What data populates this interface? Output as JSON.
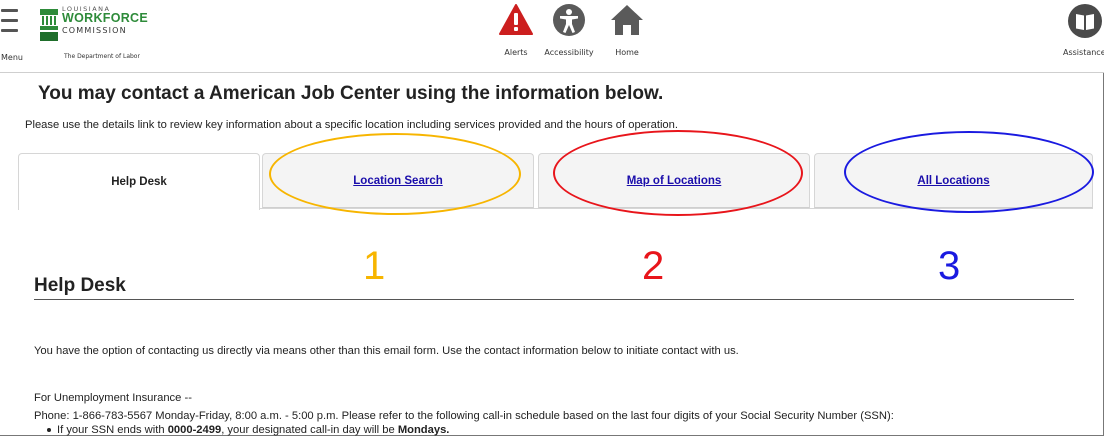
{
  "header": {
    "menu_label": "Menu",
    "logo": {
      "line1": "LOUISIANA",
      "line2": "WORKFORCE",
      "line3": "COMMISSION",
      "tagline": "The Department of Labor"
    },
    "alerts_label": "Alerts",
    "accessibility_label": "Accessibility",
    "home_label": "Home",
    "assistance_label": "Assistance",
    "icons": {
      "menu": "hamburger-icon",
      "alerts": "alert-triangle-icon",
      "accessibility": "accessibility-icon",
      "home": "home-icon",
      "assistance": "book-icon"
    },
    "colors": {
      "alerts": "#cc1f1f",
      "logo_green": "#2e8b3a",
      "icon_gray": "#5a5a5a"
    }
  },
  "main": {
    "title": "You may contact a American Job Center using the information below.",
    "subtitle": "Please use the details link to review key information about a specific location including services provided and the hours of operation."
  },
  "tabs": [
    {
      "label": "Help Desk",
      "active": true
    },
    {
      "label": "Location Search",
      "active": false
    },
    {
      "label": "Map of Locations",
      "active": false
    },
    {
      "label": "All Locations",
      "active": false
    }
  ],
  "annotations": [
    {
      "number": "1",
      "color": "#f7b500"
    },
    {
      "number": "2",
      "color": "#e8151b"
    },
    {
      "number": "3",
      "color": "#1a1ae0"
    }
  ],
  "content": {
    "section_title": "Help Desk",
    "intro": "You have the option of contacting us directly via means other than this email form. Use the contact information below to initiate contact with us.",
    "ui_heading": "For Unemployment Insurance --",
    "phone_line": "Phone: 1-866-783-5567 Monday-Friday, 8:00 a.m. - 5:00 p.m.  Please refer to the following call-in schedule based on the last four digits of your Social Security Number (SSN):",
    "bullet_prefix": "If your SSN ends with ",
    "bullet_range": "0000-2499",
    "bullet_middle": ", your designated call-in day will be ",
    "bullet_day": "Mondays."
  }
}
